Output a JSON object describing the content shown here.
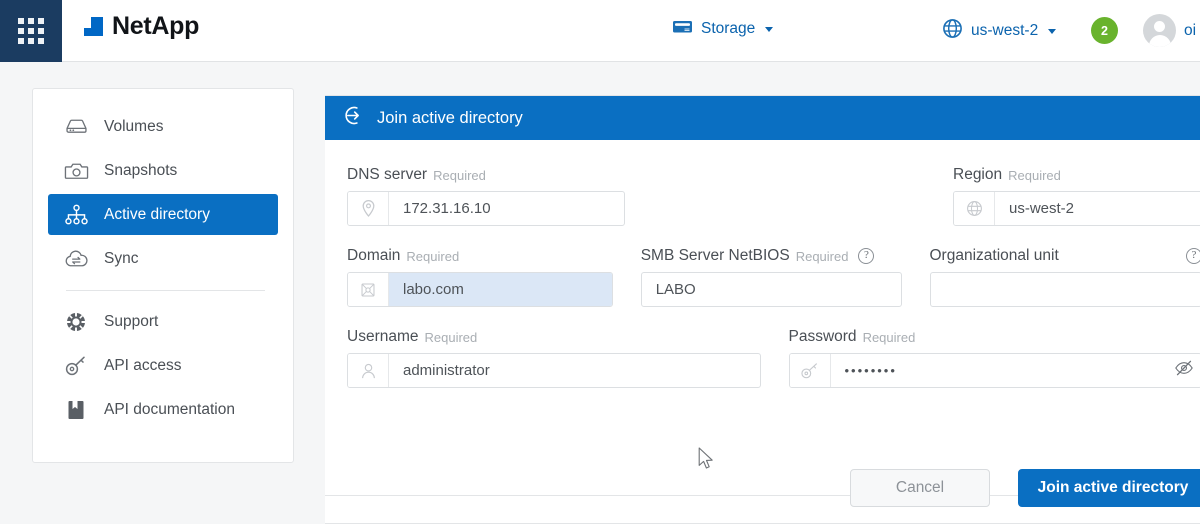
{
  "header": {
    "waffle_icon": "grid-apps-icon",
    "brand": "NetApp",
    "storage": {
      "label": "Storage",
      "icon": "storage-drive-icon"
    },
    "region": {
      "label": "us-west-2",
      "icon": "globe-icon"
    },
    "notifications": "2",
    "account_name": "oi",
    "colors": {
      "brand_blue": "#0067c5",
      "link_blue": "#0b63ad",
      "badge_green": "#69b32d"
    }
  },
  "sidebar": {
    "items": [
      {
        "label": "Volumes",
        "icon": "volume-disk-icon",
        "active": false
      },
      {
        "label": "Snapshots",
        "icon": "camera-icon",
        "active": false
      },
      {
        "label": "Active directory",
        "icon": "active-directory-nodes-icon",
        "active": true
      },
      {
        "label": "Sync",
        "icon": "cloud-sync-icon",
        "active": false
      }
    ],
    "items_secondary": [
      {
        "label": "Support",
        "icon": "life-preserver-icon"
      },
      {
        "label": "API access",
        "icon": "key-icon"
      },
      {
        "label": "API documentation",
        "icon": "book-icon"
      }
    ]
  },
  "panel": {
    "title": "Join active directory",
    "title_icon": "sign-in-arrow-icon",
    "accent": "#0a6fc2",
    "required_text": "Required",
    "fields": {
      "dns_server": {
        "label": "DNS server",
        "required": "Required",
        "value": "172.31.16.10",
        "icon": "location-pin-icon"
      },
      "region": {
        "label": "Region",
        "required": "Required",
        "value": "us-west-2",
        "icon": "globe-icon",
        "type": "select"
      },
      "domain": {
        "label": "Domain",
        "required": "Required",
        "value": "labo.com",
        "icon": "domain-network-icon",
        "highlighted": true
      },
      "smb_netbios": {
        "label": "SMB Server NetBIOS",
        "required": "Required",
        "value": "LABO",
        "help": "?"
      },
      "organizational_unit": {
        "label": "Organizational unit",
        "required": "",
        "value": "",
        "help": "?"
      },
      "username": {
        "label": "Username",
        "required": "Required",
        "value": "administrator",
        "icon": "user-icon"
      },
      "password": {
        "label": "Password",
        "required": "Required",
        "value": "••••••••",
        "icon": "key-icon",
        "reveal_icon": "eye-off-icon"
      }
    },
    "buttons": {
      "cancel": "Cancel",
      "submit": "Join active directory"
    }
  }
}
